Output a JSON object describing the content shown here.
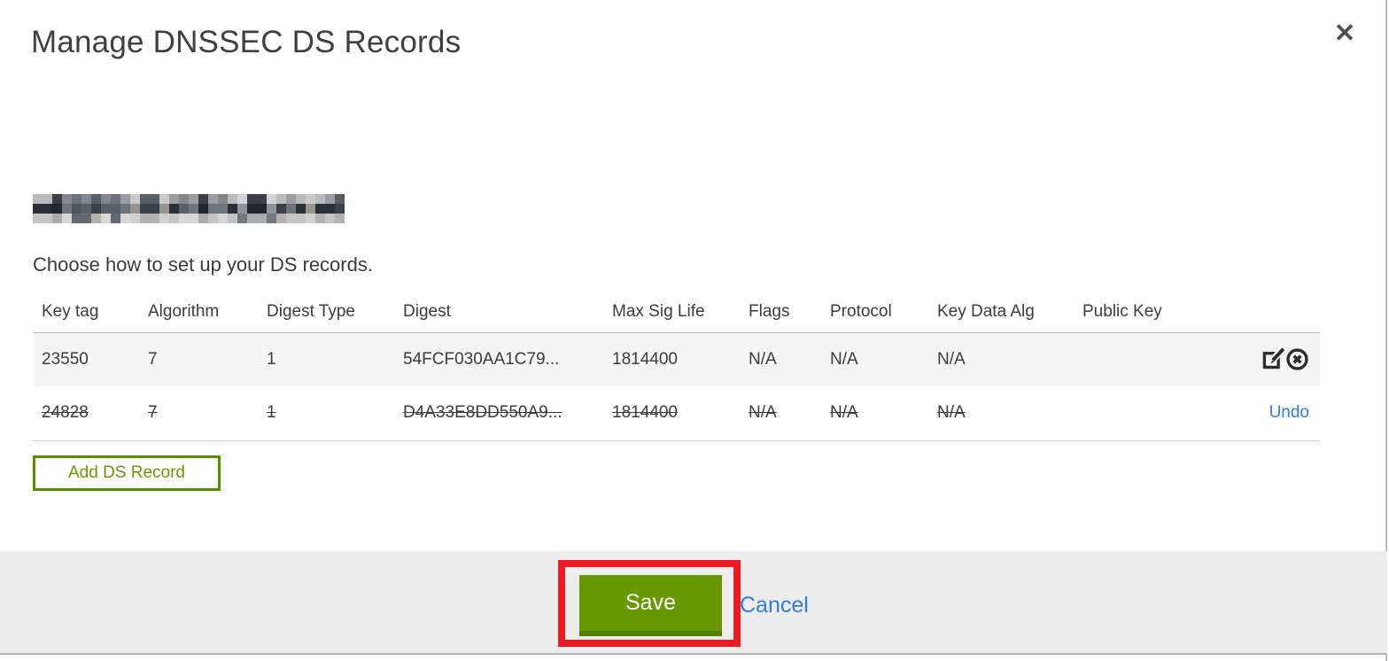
{
  "modal": {
    "title": "Manage DNSSEC DS Records",
    "close_icon": "close-icon",
    "close_glyph": "✕",
    "instruction": "Choose how to set up your DS records."
  },
  "redaction": {
    "note": "domain name pixelated for privacy",
    "cols": 32,
    "rows": 3,
    "palette_rows": [
      [
        "#b9bbbd",
        "#6d737b",
        "#3a3f47",
        "#9b9d9f",
        "#d2d3d4",
        "#585e66",
        "#83878c",
        "#c8c9ca"
      ],
      [
        "#2c3036",
        "#4e545c",
        "#23262b",
        "#6e747c",
        "#8e9298",
        "#3b4048",
        "#5a6068",
        "#97948e"
      ],
      [
        "#c2c4c6",
        "#8b9096",
        "#a9abad",
        "#d8d6d2",
        "#73787e",
        "#b4b2ae",
        "#63686f",
        "#cfd0d1"
      ]
    ]
  },
  "table": {
    "columns": {
      "key_tag": "Key tag",
      "algorithm": "Algorithm",
      "digest_type": "Digest Type",
      "digest": "Digest",
      "max_sig_life": "Max Sig Life",
      "flags": "Flags",
      "protocol": "Protocol",
      "key_data_alg": "Key Data Alg",
      "public_key": "Public Key"
    },
    "rows": [
      {
        "key_tag": "23550",
        "algorithm": "7",
        "digest_type": "1",
        "digest": "54FCF030AA1C79...",
        "max_sig_life": "1814400",
        "flags": "N/A",
        "protocol": "N/A",
        "key_data_alg": "N/A",
        "public_key": "",
        "state": "normal",
        "actions": [
          "edit-icon",
          "delete-icon"
        ]
      },
      {
        "key_tag": "24828",
        "algorithm": "7",
        "digest_type": "1",
        "digest": "D4A33E8DD550A9...",
        "max_sig_life": "1814400",
        "flags": "N/A",
        "protocol": "N/A",
        "key_data_alg": "N/A",
        "public_key": "",
        "state": "deleted",
        "undo_label": "Undo"
      }
    ]
  },
  "buttons": {
    "add_record": "Add DS Record",
    "save": "Save",
    "cancel": "Cancel"
  },
  "colors": {
    "accent_green": "#669900",
    "accent_green_dark": "#527c00",
    "add_button_border": "#549000",
    "link_blue": "#2d7de1",
    "annotation_red": "#ea1c23",
    "footer_gray": "#ececec",
    "row_stripe": "#f5f5f5",
    "text": "#3b3b3b"
  }
}
